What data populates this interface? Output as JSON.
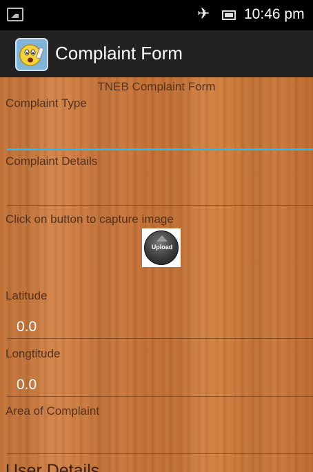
{
  "status_bar": {
    "time": "10:46 pm",
    "icons": [
      "notification-image-icon",
      "airplane-mode-icon",
      "battery-icon"
    ]
  },
  "action_bar": {
    "title": "Complaint Form",
    "app_icon": "surprised-face-icon"
  },
  "form": {
    "heading": "TNEB Complaint Form",
    "complaint_type": {
      "label": "Complaint Type",
      "value": ""
    },
    "complaint_details": {
      "label": "Complaint Details",
      "value": ""
    },
    "capture": {
      "label": "Click on button to capture image",
      "button_label": "Upload"
    },
    "latitude": {
      "label": "Latitude",
      "value": "0.0"
    },
    "longitude": {
      "label": "Longtitude",
      "value": "0.0"
    },
    "area": {
      "label": "Area of Complaint",
      "value": ""
    },
    "next_section": "User Details"
  },
  "colors": {
    "accent_underline": "#33b5e5",
    "action_bar": "#222222",
    "background_wood": "#c8773b"
  }
}
